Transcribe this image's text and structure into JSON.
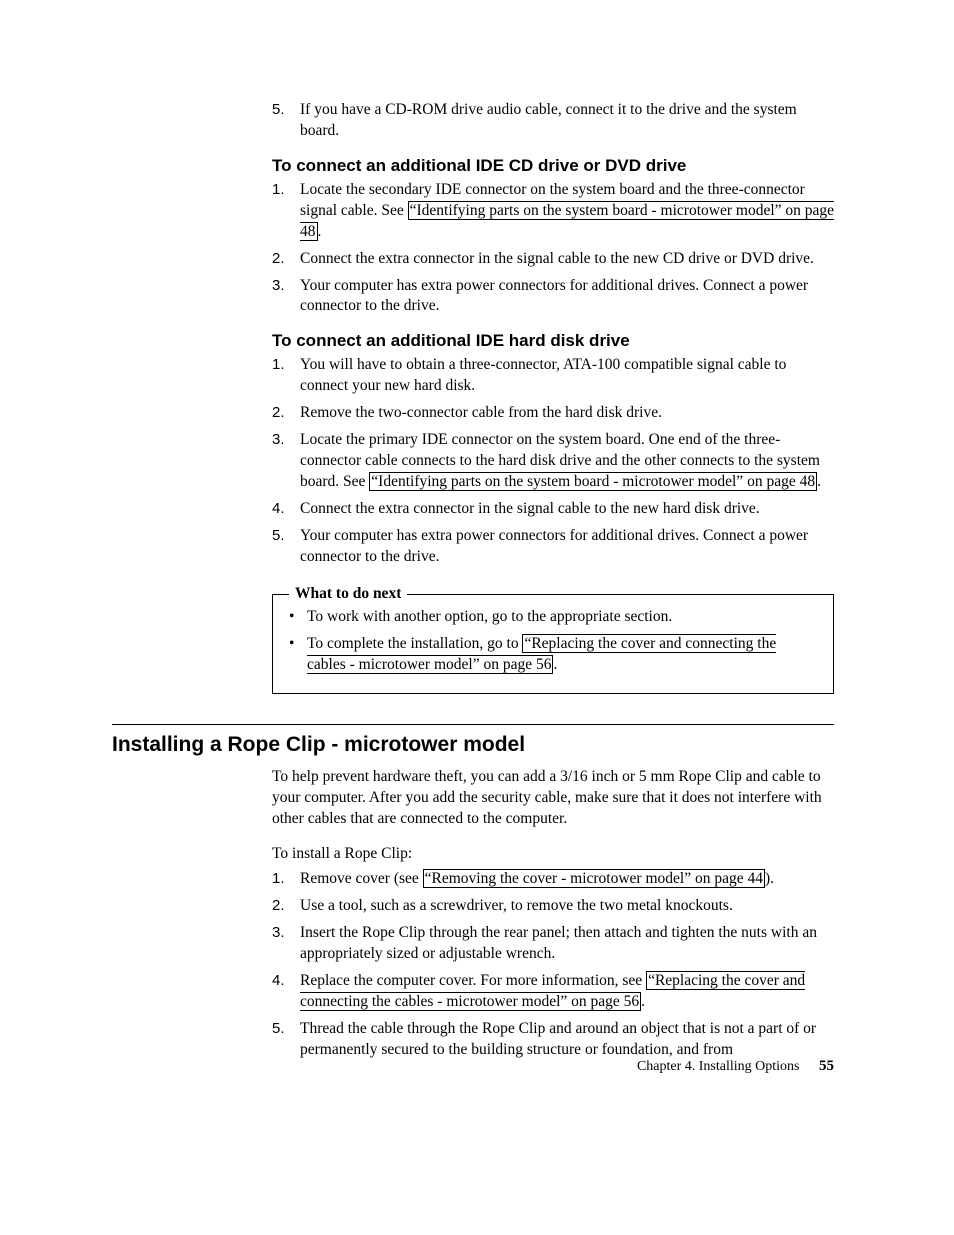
{
  "top_list": {
    "items": [
      {
        "num": "5.",
        "text": "If you have a CD-ROM drive audio cable, connect it to the drive and the system board."
      }
    ]
  },
  "sec_cd": {
    "heading": "To connect an additional IDE CD drive or DVD drive",
    "items": [
      {
        "num": "1.",
        "pre": "Locate the secondary IDE connector on the system board and the three-connector signal cable. See ",
        "link": "“Identifying parts on the system board - microtower model” on page 48",
        "post": "."
      },
      {
        "num": "2.",
        "text": "Connect the extra connector in the signal cable to the new CD drive or DVD drive."
      },
      {
        "num": "3.",
        "text": "Your computer has extra power connectors for additional drives. Connect a power connector to the drive."
      }
    ]
  },
  "sec_hd": {
    "heading": "To connect an additional IDE hard disk drive",
    "items": [
      {
        "num": "1.",
        "text": "You will have to obtain a three-connector, ATA-100 compatible signal cable to connect your new hard disk."
      },
      {
        "num": "2.",
        "text": "Remove the two-connector cable from the hard disk drive."
      },
      {
        "num": "3.",
        "pre": "Locate the primary IDE connector on the system board. One end of the three-connector cable connects to the hard disk drive and the other connects to the system board. See ",
        "link": "“Identifying parts on the system board - microtower model” on page 48",
        "post": "."
      },
      {
        "num": "4.",
        "text": "Connect the extra connector in the signal cable to the new hard disk drive."
      },
      {
        "num": "5.",
        "text": "Your computer has extra power connectors for additional drives. Connect a power connector to the drive."
      }
    ]
  },
  "next_box": {
    "legend": "What to do next",
    "items": [
      {
        "text": "To work with another option, go to the appropriate section."
      },
      {
        "pre": "To complete the installation, go to ",
        "link": "“Replacing the cover and connecting the cables - microtower model” on page 56",
        "post": "."
      }
    ]
  },
  "rope": {
    "title": "Installing a Rope Clip - microtower model",
    "intro": "To help prevent hardware theft, you can add a 3/16 inch or 5 mm Rope Clip and cable to your computer. After you add the security cable, make sure that it does not interfere with other cables that are connected to the computer.",
    "lead": "To install a Rope Clip:",
    "items": [
      {
        "num": "1.",
        "pre": "Remove cover (see ",
        "link": "“Removing the cover - microtower model” on page 44",
        "post": ")."
      },
      {
        "num": "2.",
        "text": "Use a tool, such as a screwdriver, to remove the two metal knockouts."
      },
      {
        "num": "3.",
        "text": "Insert the Rope Clip through the rear panel; then attach and tighten the nuts with an appropriately sized or adjustable wrench."
      },
      {
        "num": "4.",
        "pre": "Replace the computer cover. For more information, see ",
        "link": "“Replacing the cover and connecting the cables - microtower model” on page 56",
        "post": "."
      },
      {
        "num": "5.",
        "text": "Thread the cable through the Rope Clip and around an object that is not a part of or permanently secured to the building structure or foundation, and from"
      }
    ]
  },
  "footer": {
    "chapter": "Chapter 4. Installing Options",
    "page": "55"
  }
}
